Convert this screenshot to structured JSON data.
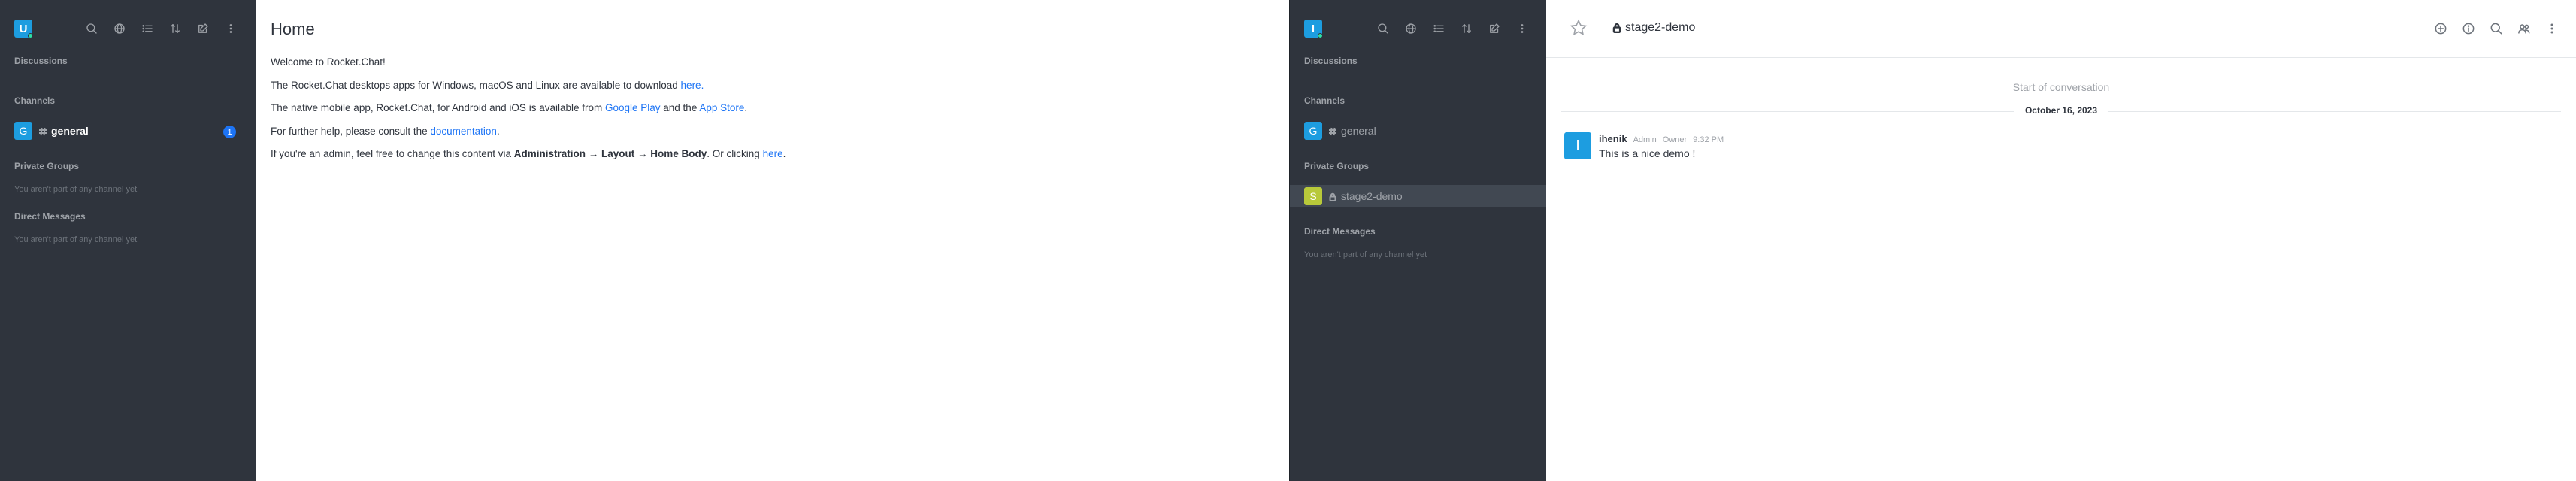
{
  "left_sidebar": {
    "user_avatar_letter": "U",
    "sections": {
      "discussions": "Discussions",
      "channels": "Channels",
      "private_groups": "Private Groups",
      "direct_messages": "Direct Messages"
    },
    "channels": [
      {
        "letter": "G",
        "name": "general",
        "unread": "1",
        "avatar_color": "#1d9de0"
      }
    ],
    "private_groups_empty": "You aren't part of any channel yet",
    "direct_messages_empty": "You aren't part of any channel yet"
  },
  "home": {
    "title": "Home",
    "line1": "Welcome to Rocket.Chat!",
    "line2_text": "The Rocket.Chat desktops apps for Windows, macOS and Linux are available to download ",
    "line2_link": "here.",
    "line3_text": "The native mobile app, Rocket.Chat, for Android and iOS is available from ",
    "line3_link1": "Google Play",
    "line3_mid": " and the ",
    "line3_link2": "App Store",
    "line3_end": ".",
    "line4_text": "For further help, please consult the ",
    "line4_link": "documentation",
    "line4_end": ".",
    "line5_text": "If you're an admin, feel free to change this content via ",
    "line5_bold": "Administration → Layout → Home Body",
    "line5_mid": ". Or clicking ",
    "line5_link": "here",
    "line5_end": "."
  },
  "right_sidebar": {
    "user_avatar_letter": "I",
    "sections": {
      "discussions": "Discussions",
      "channels": "Channels",
      "private_groups": "Private Groups",
      "direct_messages": "Direct Messages"
    },
    "channels": [
      {
        "letter": "G",
        "name": "general",
        "avatar_color": "#1d9de0"
      }
    ],
    "private_groups": [
      {
        "letter": "S",
        "name": "stage2-demo",
        "avatar_color": "#b8c93a"
      }
    ],
    "direct_messages_empty": "You aren't part of any channel yet"
  },
  "room": {
    "name": "stage2-demo",
    "start_of_conversation": "Start of conversation",
    "date_divider": "October 16, 2023",
    "messages": [
      {
        "avatar_letter": "I",
        "username": "ihenik",
        "role1": "Admin",
        "role2": "Owner",
        "time": "9:32 PM",
        "text": "This is a nice demo !"
      }
    ]
  },
  "colors": {
    "sidebar_bg": "#2f343d",
    "accent": "#1d74f5",
    "avatar_blue": "#1d9de0",
    "avatar_lime": "#b8c93a"
  }
}
